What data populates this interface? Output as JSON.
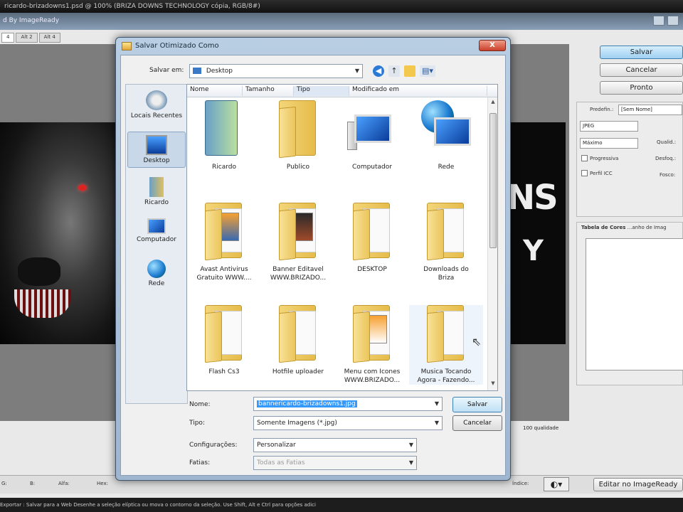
{
  "app": {
    "title_bar": "ricardo-brizadowns1.psd @ 100% (BRIZA DOWNS TECHNOLOGY cópia, RGB/8#)",
    "subtitle": "d By ImageReady",
    "tabs": [
      "4",
      "Alt 2",
      "Alt 4"
    ],
    "right_buttons": {
      "save": "Salvar",
      "cancel": "Cancelar",
      "done": "Pronto"
    },
    "settings": {
      "preset_label": "Predefin.:",
      "preset_value": "[Sem Nome]",
      "format_value": "JPEG",
      "quality_value": "Máximo",
      "progressive": "Progressiva",
      "icc": "Perfil ICC",
      "qual_label": "Qualid.:",
      "blur_label": "Desfoq.:",
      "matte_label": "Fosco:"
    },
    "color_table_tab": "Tabela de Cores",
    "image_size_tab": "...anho de Imag",
    "quality_readout": "100 qualidade",
    "bottom_left": [
      "G:",
      "B:",
      "Alfa:",
      "Hex:",
      "Índice:"
    ],
    "edit_button": "Editar no ImageReady",
    "status": "Exportar : Salvar para a Web                                                    Desenhe a seleção elíptica ou mova o contorno da seleção. Use Shift, Alt e Ctrl para opções adici",
    "banner_text1": "NS",
    "banner_text2": "Y"
  },
  "dialog": {
    "title": "Salvar Otimizado Como",
    "close": "X",
    "save_in_label": "Salvar em:",
    "save_in_value": "Desktop",
    "places": [
      "Locais Recentes",
      "Desktop",
      "Ricardo",
      "Computador",
      "Rede"
    ],
    "columns": [
      "Nome",
      "Tamanho",
      "Tipo",
      "Modificado em"
    ],
    "items": [
      {
        "line1": "Ricardo",
        "line2": ""
      },
      {
        "line1": "Publico",
        "line2": ""
      },
      {
        "line1": "Computador",
        "line2": ""
      },
      {
        "line1": "Rede",
        "line2": ""
      },
      {
        "line1": "Avast Antivirus",
        "line2": "Gratuito WWW...."
      },
      {
        "line1": "Banner Editavel",
        "line2": "WWW.BRIZADO..."
      },
      {
        "line1": "DESKTOP",
        "line2": ""
      },
      {
        "line1": "Downloads do",
        "line2": "Briza"
      },
      {
        "line1": "Flash Cs3",
        "line2": ""
      },
      {
        "line1": "Hotfile uploader",
        "line2": ""
      },
      {
        "line1": "Menu com Icones",
        "line2": "WWW.BRIZADO..."
      },
      {
        "line1": "Musica Tocando",
        "line2": "Agora - Fazendo..."
      }
    ],
    "name_label": "Nome:",
    "name_value": "bannericardo-brizadowns1.jpg",
    "type_label": "Tipo:",
    "type_value": "Somente Imagens (*.jpg)",
    "config_label": "Configurações:",
    "config_value": "Personalizar",
    "slices_label": "Fatias:",
    "slices_value": "Todas as Fatias",
    "save_button": "Salvar",
    "cancel_button": "Cancelar"
  },
  "colors": {
    "accent": "#3399ff",
    "dialog_frame": "#9fb6cf"
  }
}
